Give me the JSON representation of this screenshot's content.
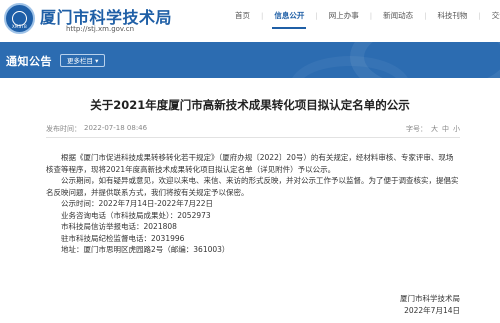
{
  "header": {
    "site_title": "厦门市科学技术局",
    "site_url": "http://stj.xm.gov.cn",
    "logo_text": "XMSTB",
    "nav": [
      {
        "label": "首页",
        "active": false
      },
      {
        "label": "信息公开",
        "active": true
      },
      {
        "label": "网上办事",
        "active": false
      },
      {
        "label": "新闻动态",
        "active": false
      },
      {
        "label": "科技刊物",
        "active": false
      },
      {
        "label": "交流互动",
        "active": false
      }
    ]
  },
  "banner": {
    "title": "通知公告",
    "more_label": "更多栏目 ▾"
  },
  "article": {
    "title": "关于2021年度厦门市高新技术成果转化项目拟认定名单的公示",
    "date_label": "发布时间：",
    "date": "2022-07-18 08:46",
    "font_size_label": "字号：",
    "font_large": "大",
    "font_medium": "中",
    "font_small": "小",
    "paragraphs": {
      "p1": "根据《厦门市促进科技成果转移转化若干规定》（厦府办规〔2022〕20号）的有关规定，经材料审核、专家评审、现场核查等程序，现将2021年度高新技术成果转化项目拟认定名单（详见附件）予以公示。",
      "p2": "公示期间，如有疑异或意见，欢迎以来电、来信、来访的形式反映，并对公示工作予以监督。为了便于调查核实，提倡实名反映问题，并提供联系方式，我们将按有关规定予以保密。",
      "l1": "公示时间：2022年7月14日-2022年7月22日",
      "l2": "业务咨询电话（市科技局成果处）：2052973",
      "l3": "市科技局信访举报电话：2021808",
      "l4": "驻市科技局纪检监督电话：2031996",
      "l5": "地址：厦门市思明区虎园路2号（邮编：361003）"
    },
    "signature": {
      "org": "厦门市科学技术局",
      "date": "2022年7月14日"
    }
  },
  "colors": {
    "brand_blue": "#1f5fa6",
    "banner_blue": "#2c6cb1"
  }
}
